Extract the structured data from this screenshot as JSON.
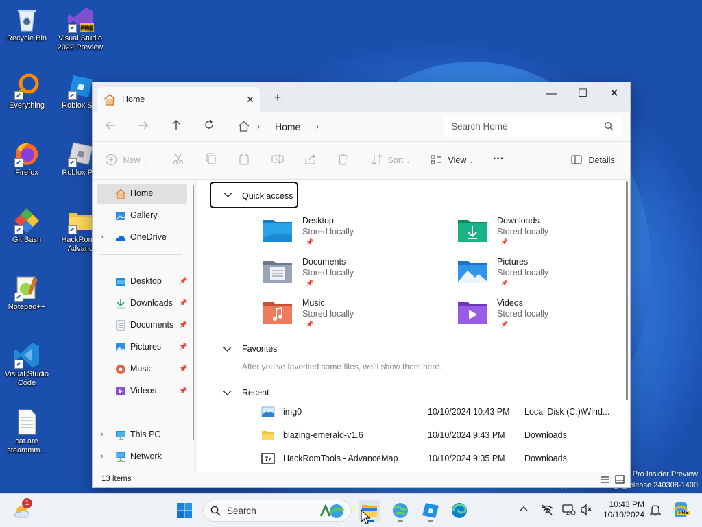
{
  "desktop": {
    "icons": [
      {
        "label": "Recycle Bin"
      },
      {
        "label": "Visual Studio 2022 Preview",
        "badge": "PRE"
      },
      {
        "label": "Everything"
      },
      {
        "label": "Roblox Stu"
      },
      {
        "label": "Firefox"
      },
      {
        "label": "Roblox Pla"
      },
      {
        "label": "Git Bash"
      },
      {
        "label": "HackRom - Advanc"
      },
      {
        "label": "Notepad++"
      },
      {
        "label": "Visual Studio Code"
      },
      {
        "label": "cat are steammm..."
      }
    ],
    "watermark_line1": "Pro Insider Preview",
    "watermark_line2": "Evaluation copy. Build 26080.ge_release.240308-1400"
  },
  "window": {
    "tab": {
      "label": "Home",
      "close": "✕"
    },
    "new_tab": "+",
    "controls": {
      "minimize": "—",
      "maximize": "☐",
      "close": "✕"
    },
    "address": {
      "crumb": "Home"
    },
    "search": {
      "placeholder": "Search Home"
    },
    "commands": {
      "new": "New",
      "sort": "Sort",
      "view": "View",
      "more": "···",
      "details": "Details"
    },
    "nav": {
      "top": [
        {
          "label": "Home"
        },
        {
          "label": "Gallery"
        },
        {
          "label": "OneDrive"
        }
      ],
      "pinned": [
        {
          "label": "Desktop"
        },
        {
          "label": "Downloads"
        },
        {
          "label": "Documents"
        },
        {
          "label": "Pictures"
        },
        {
          "label": "Music"
        },
        {
          "label": "Videos"
        }
      ],
      "bottom": [
        {
          "label": "This PC"
        },
        {
          "label": "Network"
        }
      ]
    },
    "quick_access": {
      "title": "Quick access",
      "items": [
        {
          "name": "Desktop",
          "sub": "Stored locally",
          "color": "#1e8fd8"
        },
        {
          "name": "Downloads",
          "sub": "Stored locally",
          "color": "#19a57a"
        },
        {
          "name": "Documents",
          "sub": "Stored locally",
          "color": "#8a96a8"
        },
        {
          "name": "Pictures",
          "sub": "Stored locally",
          "color": "#2c8fe3"
        },
        {
          "name": "Music",
          "sub": "Stored locally",
          "color": "#e5644a"
        },
        {
          "name": "Videos",
          "sub": "Stored locally",
          "color": "#8a4fd6"
        }
      ]
    },
    "favorites": {
      "title": "Favorites",
      "message": "After you've favorited some files, we'll show them here."
    },
    "recent": {
      "title": "Recent",
      "rows": [
        {
          "name": "img0",
          "date": "10/10/2024 10:43 PM",
          "location": "Local Disk (C:)\\Wind..."
        },
        {
          "name": "blazing-emerald-v1.6",
          "date": "10/10/2024 9:43 PM",
          "location": "Downloads"
        },
        {
          "name": "HackRomTools - AdvanceMap",
          "date": "10/10/2024 9:35 PM",
          "location": "Downloads"
        }
      ]
    },
    "status": {
      "count": "13 items"
    }
  },
  "taskbar": {
    "weather_badge": "1",
    "search_label": "Search",
    "time": "10:43 PM",
    "date": "10/10/2024",
    "copilot_badge": "PRE"
  },
  "colors": {
    "accent": "#0067c0",
    "folder_yellow": "#f3c443"
  }
}
